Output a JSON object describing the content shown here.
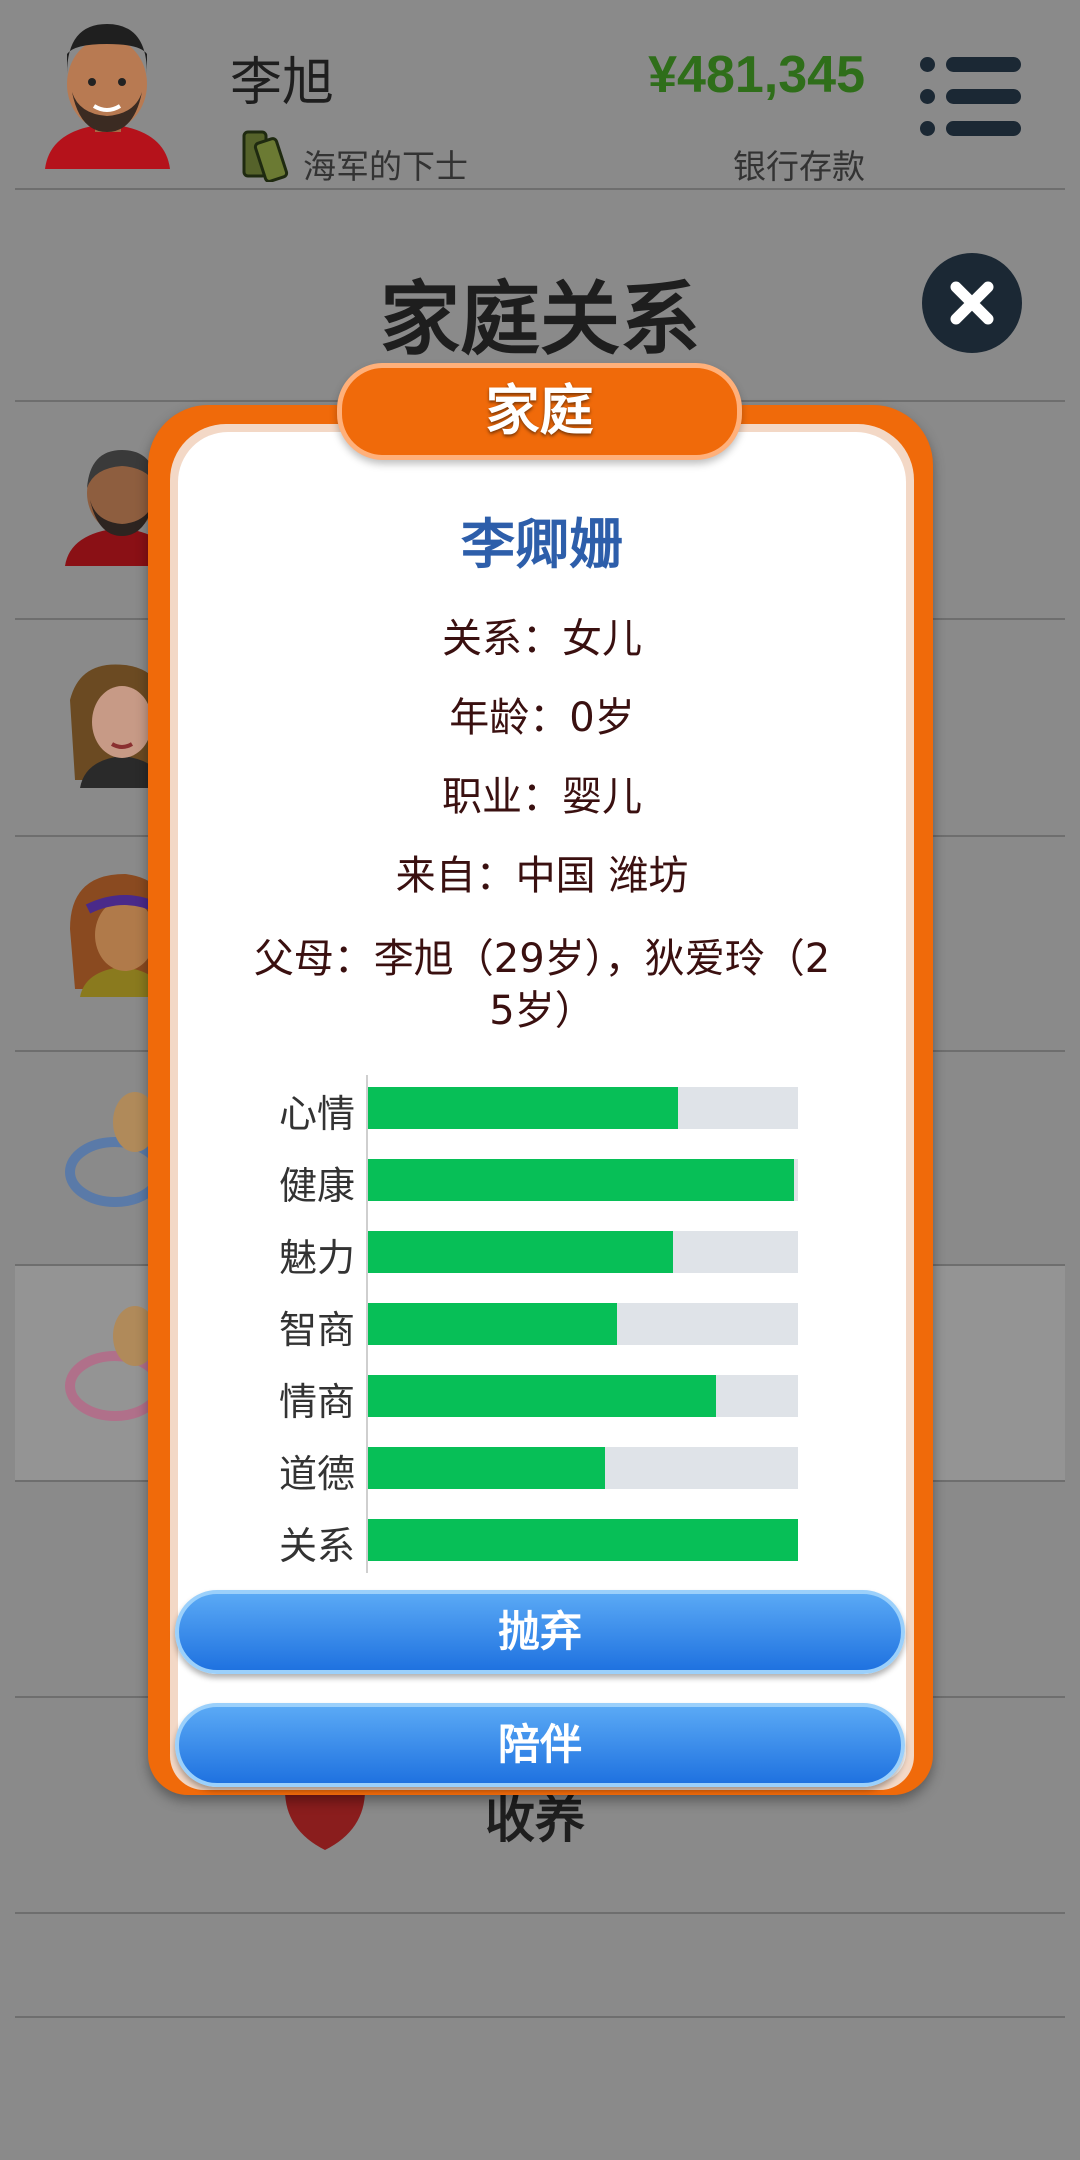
{
  "header": {
    "name": "李旭",
    "rank": "海军的下士",
    "money": "¥481,345",
    "money_label": "银行存款"
  },
  "page_title": "家庭关系",
  "background_list": {
    "adopt_label": "收养"
  },
  "modal": {
    "tab_label": "家庭",
    "person_name": "李卿姗",
    "info_lines": [
      "关系：女儿",
      "年龄：0岁",
      "职业：婴儿",
      "来自：中国 潍坊",
      "父母：李旭（29岁），狄爱玲（2",
      "5岁）"
    ],
    "stats": [
      {
        "label": "心情",
        "value": 0.72
      },
      {
        "label": "健康",
        "value": 0.99
      },
      {
        "label": "魅力",
        "value": 0.71
      },
      {
        "label": "智商",
        "value": 0.58
      },
      {
        "label": "情商",
        "value": 0.81
      },
      {
        "label": "道德",
        "value": 0.55
      },
      {
        "label": "关系",
        "value": 1.0
      }
    ],
    "buttons": {
      "abandon": "抛弃",
      "accompany": "陪伴"
    }
  },
  "colors": {
    "stat_fill": "#07bf57",
    "money": "#2f6e1a",
    "modal_orange": "#f06a0a"
  }
}
